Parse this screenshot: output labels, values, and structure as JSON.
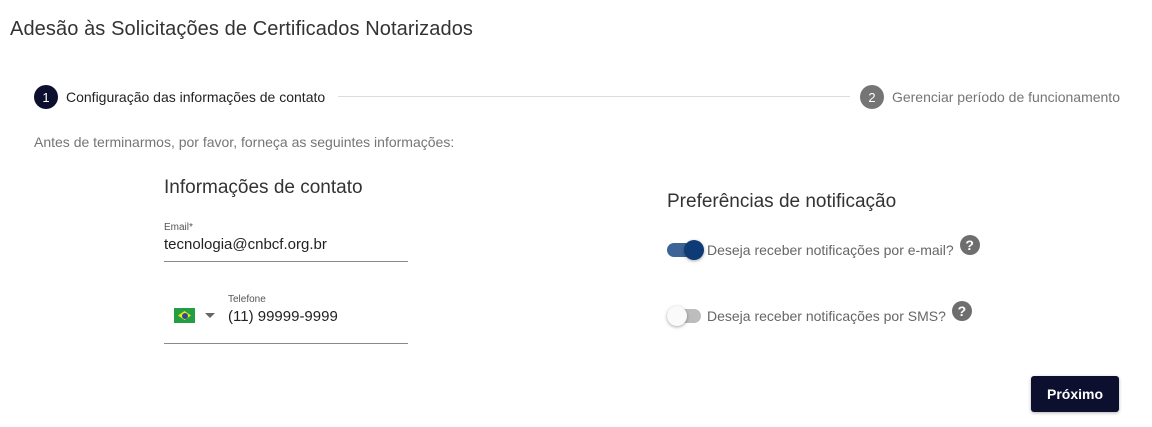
{
  "page_title": "Adesão às Solicitações de Certificados Notarizados",
  "stepper": {
    "steps": [
      {
        "number": "1",
        "label": "Configuração das informações de contato",
        "state": "active"
      },
      {
        "number": "2",
        "label": "Gerenciar período de funcionamento",
        "state": "inactive"
      }
    ]
  },
  "intro_text": "Antes de terminarmos, por favor, forneça as seguintes informações:",
  "contact": {
    "title": "Informações de contato",
    "email": {
      "label": "Email*",
      "value": "tecnologia@cnbcf.org.br"
    },
    "phone": {
      "label": "Telefone",
      "value": "(11) 99999-9999",
      "country_flag": "brazil-flag-icon"
    }
  },
  "notifications": {
    "title": "Preferências de notificação",
    "email_pref": {
      "label": "Deseja receber notificações por e-mail?",
      "enabled": true
    },
    "sms_pref": {
      "label": "Deseja receber notificações por SMS?",
      "enabled": false
    },
    "help_glyph": "?"
  },
  "actions": {
    "next_label": "Próximo"
  },
  "colors": {
    "primary": "#0c0f2e",
    "toggle_on": "#0e3b75",
    "muted": "#757575"
  }
}
